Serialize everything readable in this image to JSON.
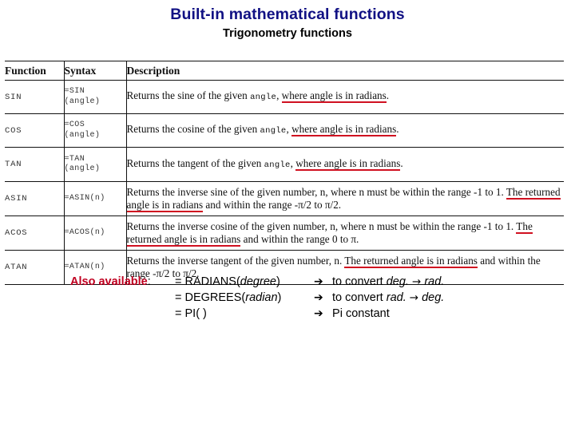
{
  "slide": {
    "title": "Built-in mathematical functions",
    "subtitle": "Trigonometry functions",
    "title_color": "#111184",
    "accent_red": "#C00020",
    "underline_red": "#d01020"
  },
  "table": {
    "headers": [
      "Function",
      "Syntax",
      "Description"
    ],
    "rows": [
      {
        "function": "SIN",
        "syntax": "=SIN\n(angle)",
        "desc_pre": "Returns the sine of the given ",
        "desc_arg": "angle",
        "desc_mid": ", ",
        "desc_underlined": "where angle is in radians",
        "desc_post": "."
      },
      {
        "function": "COS",
        "syntax": "=COS\n(angle)",
        "desc_pre": "Returns the cosine of the given ",
        "desc_arg": "angle",
        "desc_mid": ", ",
        "desc_underlined": "where angle is in radians",
        "desc_post": "."
      },
      {
        "function": "TAN",
        "syntax": "=TAN\n(angle)",
        "desc_pre": "Returns the tangent of the given ",
        "desc_arg": "angle",
        "desc_mid": ", ",
        "desc_underlined": "where angle is in radians",
        "desc_post": "."
      },
      {
        "function": "ASIN",
        "syntax": "=ASIN(n)",
        "desc_pre": "Returns the inverse sine of the given number, n, where n must be within the range -1 to 1. ",
        "desc_underlined": "The returned angle is in radians",
        "desc_post": " and within the range -π/2 to π/2."
      },
      {
        "function": "ACOS",
        "syntax": "=ACOS(n)",
        "desc_pre": "Returns the inverse cosine of the given number, n, where n must be within the range -1 to 1. ",
        "desc_underlined": "The returned angle is in radians",
        "desc_post": " and within the range 0 to π."
      },
      {
        "function": "ATAN",
        "syntax": "=ATAN(n)",
        "desc_pre": "Returns the inverse tangent of the given number, n. ",
        "desc_underlined": "The returned angle is in radians",
        "desc_post": " and within the range -π/2 to π/2."
      }
    ]
  },
  "also_available": {
    "label": "Also available",
    "colon": ":",
    "lead_arrow": "➔",
    "inline_arrow": "→",
    "items": [
      {
        "expr_pre": "= RADIANS(",
        "expr_arg": "degree",
        "expr_post": ")",
        "note_pre": " to convert ",
        "note_arg1": "deg.",
        "note_arg2": "rad.",
        "note_mid": " ",
        "note_post": ""
      },
      {
        "expr_pre": "= DEGREES(",
        "expr_arg": "radian",
        "expr_post": ")",
        "note_pre": " to convert ",
        "note_arg1": "rad.",
        "note_arg2": "deg.",
        "note_mid": " ",
        "note_post": ""
      },
      {
        "expr_pre": "= PI( )",
        "expr_arg": "",
        "expr_post": "",
        "note_plain": " Pi constant"
      }
    ]
  }
}
